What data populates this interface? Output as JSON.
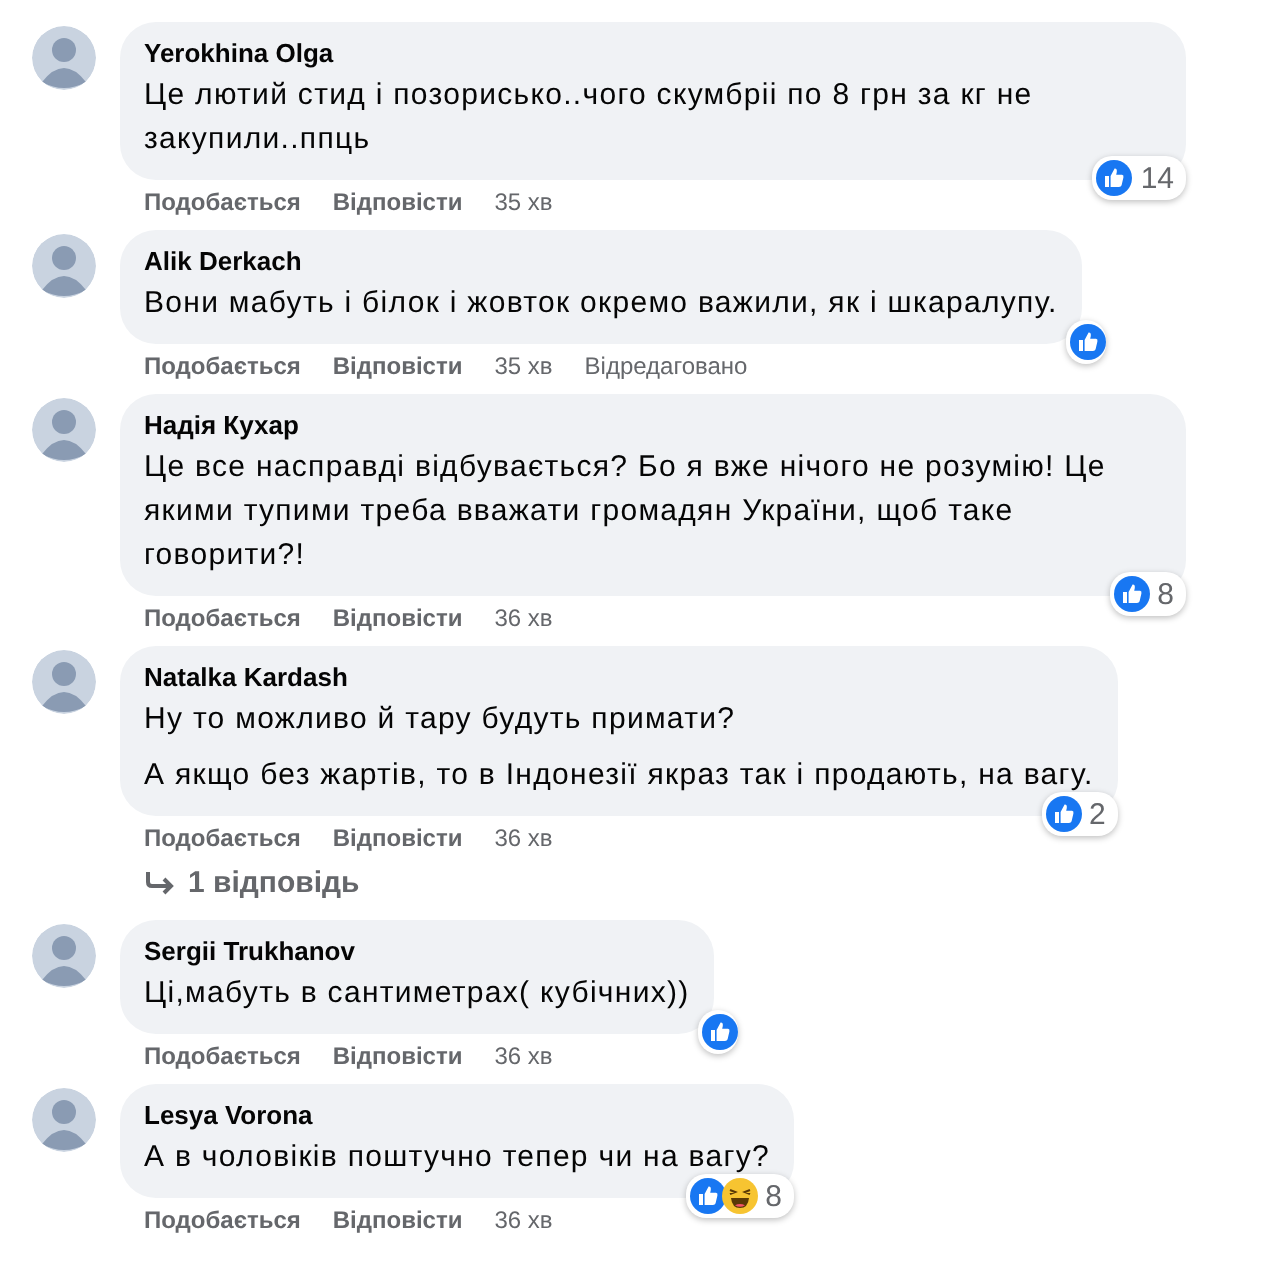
{
  "comments": [
    {
      "author": "Yerokhina Olga",
      "paragraphs": [
        "Це лютий стид і позорисько..чого скумбріі по 8 грн за кг не закупили..ппць"
      ],
      "actions": [
        "Подобається",
        "Відповісти"
      ],
      "time": "35 хв",
      "reactions": {
        "kinds": [
          {
            "kind": "like"
          }
        ],
        "count": "14"
      }
    },
    {
      "author": "Alik Derkach",
      "paragraphs": [
        "Вони мабуть і білок і жовток окремо важили, як і шкаралупу."
      ],
      "actions": [
        "Подобається",
        "Відповісти"
      ],
      "time": "35 хв",
      "edited": "Відредаговано",
      "reactions": {
        "kinds": [
          {
            "kind": "like"
          }
        ]
      }
    },
    {
      "author": "Надія Кухар",
      "paragraphs": [
        "Це все насправді відбувається? Бо я вже нічого не розумію! Це якими тупими треба вважати громадян України, щоб таке говорити?!"
      ],
      "actions": [
        "Подобається",
        "Відповісти"
      ],
      "time": "36 хв",
      "reactions": {
        "kinds": [
          {
            "kind": "like"
          }
        ],
        "count": "8"
      }
    },
    {
      "author": "Natalka Kardash",
      "paragraphs": [
        "Ну то можливо й тару будуть примати?",
        "А якщо без жартів, то в Індонезії якраз так і продають, на вагу."
      ],
      "actions": [
        "Подобається",
        "Відповісти"
      ],
      "time": "36 хв",
      "reactions": {
        "kinds": [
          {
            "kind": "like"
          }
        ],
        "count": "2"
      },
      "replies_link": "1 відповідь"
    },
    {
      "author": "Sergii Trukhanov",
      "paragraphs": [
        "Ці,мабуть в сантиметрах( кубічних))"
      ],
      "actions": [
        "Подобається",
        "Відповісти"
      ],
      "time": "36 хв",
      "reactions": {
        "kinds": [
          {
            "kind": "like"
          }
        ]
      }
    },
    {
      "author": "Lesya Vorona",
      "paragraphs": [
        "А в чоловіків поштучно тепер чи на вагу?"
      ],
      "actions": [
        "Подобається",
        "Відповісти"
      ],
      "time": "36 хв",
      "reactions": {
        "kinds": [
          {
            "kind": "like"
          },
          {
            "kind": "haha"
          }
        ],
        "count": "8"
      }
    }
  ]
}
